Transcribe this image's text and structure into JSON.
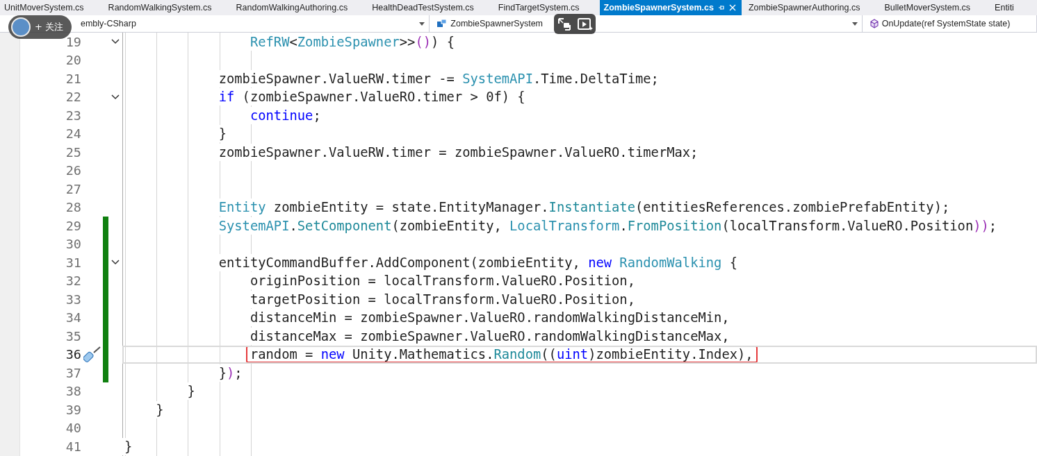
{
  "tabs": [
    {
      "label": "UnitMoverSystem.cs",
      "selected": false
    },
    {
      "label": "RandomWalkingSystem.cs",
      "selected": false
    },
    {
      "label": "RandomWalkingAuthoring.cs",
      "selected": false
    },
    {
      "label": "HealthDeadTestSystem.cs",
      "selected": false
    },
    {
      "label": "FindTargetSystem.cs",
      "selected": false
    },
    {
      "label": "ZombieSpawnerSystem.cs",
      "selected": true
    },
    {
      "label": "ZombieSpawnerAuthoring.cs",
      "selected": false
    },
    {
      "label": "BulletMoverSystem.cs",
      "selected": false
    },
    {
      "label": "Entiti",
      "selected": false
    }
  ],
  "navigation_bar": {
    "project": "embly-CSharp",
    "type": "ZombieSpawnerSystem",
    "member": "OnUpdate(ref SystemState state)"
  },
  "video_overlay": {
    "follow_label": "+ 关注"
  },
  "editor": {
    "lines": [
      {
        "number": "19",
        "fold": true,
        "changed": false,
        "current": false,
        "boxed": false,
        "tokens": [
          {
            "t": "                RefRW",
            "kind": "type"
          },
          {
            "t": "<",
            "kind": "plain"
          },
          {
            "t": "ZombieSpawner",
            "kind": "type"
          },
          {
            "t": ">>",
            "kind": "plain"
          },
          {
            "t": "()",
            "kind": "paren"
          },
          {
            "t": ") {",
            "kind": "plain"
          }
        ]
      },
      {
        "number": "20",
        "fold": false,
        "changed": false,
        "current": false
      },
      {
        "number": "21",
        "fold": false,
        "changed": false,
        "current": false,
        "boxed": false,
        "tokens": [
          {
            "t": "            zombieSpawner.ValueRW.timer -= ",
            "kind": "plain"
          },
          {
            "t": "SystemAPI",
            "kind": "type"
          },
          {
            "t": ".Time.DeltaTime;",
            "kind": "plain"
          }
        ]
      },
      {
        "number": "22",
        "fold": true,
        "changed": false,
        "current": false,
        "boxed": false,
        "tokens": [
          {
            "t": "            if",
            "kind": "keyword"
          },
          {
            "t": " (zombieSpawner.ValueRO.timer > 0f) {",
            "kind": "plain"
          }
        ]
      },
      {
        "number": "23",
        "fold": false,
        "changed": false,
        "current": false,
        "boxed": false,
        "tokens": [
          {
            "t": "                continue",
            "kind": "keyword"
          },
          {
            "t": ";",
            "kind": "plain"
          }
        ]
      },
      {
        "number": "24",
        "fold": false,
        "changed": false,
        "current": false,
        "boxed": false,
        "tokens": [
          {
            "t": "            }",
            "kind": "plain"
          }
        ]
      },
      {
        "number": "25",
        "fold": false,
        "changed": false,
        "current": false,
        "boxed": false,
        "tokens": [
          {
            "t": "            zombieSpawner.ValueRW.timer = zombieSpawner.ValueRO.timerMax;",
            "kind": "plain"
          }
        ]
      },
      {
        "number": "26",
        "fold": false,
        "changed": false,
        "current": false
      },
      {
        "number": "27",
        "fold": false,
        "changed": false,
        "current": false
      },
      {
        "number": "28",
        "fold": false,
        "changed": false,
        "current": false,
        "boxed": false,
        "tokens": [
          {
            "t": "            Entity",
            "kind": "type"
          },
          {
            "t": " zombieEntity = state.EntityManager.",
            "kind": "plain"
          },
          {
            "t": "Instantiate",
            "kind": "method"
          },
          {
            "t": "(entitiesReferences.zombiePrefabEntity);",
            "kind": "plain"
          }
        ]
      },
      {
        "number": "29",
        "fold": false,
        "changed": true,
        "current": false,
        "boxed": false,
        "tokens": [
          {
            "t": "            SystemAPI",
            "kind": "type"
          },
          {
            "t": ".",
            "kind": "plain"
          },
          {
            "t": "SetComponent",
            "kind": "method"
          },
          {
            "t": "(zombieEntity, ",
            "kind": "plain"
          },
          {
            "t": "LocalTransform",
            "kind": "type"
          },
          {
            "t": ".",
            "kind": "plain"
          },
          {
            "t": "FromPosition",
            "kind": "method"
          },
          {
            "t": "(localTransform.ValueRO.Position",
            "kind": "plain"
          },
          {
            "t": "))",
            "kind": "paren"
          },
          {
            "t": ";",
            "kind": "plain"
          }
        ]
      },
      {
        "number": "30",
        "fold": false,
        "changed": true,
        "current": false
      },
      {
        "number": "31",
        "fold": true,
        "changed": true,
        "current": false,
        "boxed": false,
        "tokens": [
          {
            "t": "            entityCommandBuffer.AddComponent(zombieEntity, ",
            "kind": "plain"
          },
          {
            "t": "new",
            "kind": "keyword"
          },
          {
            "t": " RandomWalking",
            "kind": "type"
          },
          {
            "t": " {",
            "kind": "plain"
          }
        ]
      },
      {
        "number": "32",
        "fold": false,
        "changed": true,
        "current": false,
        "boxed": false,
        "tokens": [
          {
            "t": "                originPosition = localTransform.ValueRO.Position,",
            "kind": "plain"
          }
        ]
      },
      {
        "number": "33",
        "fold": false,
        "changed": true,
        "current": false,
        "boxed": false,
        "tokens": [
          {
            "t": "                targetPosition = localTransform.ValueRO.Position,",
            "kind": "plain"
          }
        ]
      },
      {
        "number": "34",
        "fold": false,
        "changed": true,
        "current": false,
        "boxed": false,
        "tokens": [
          {
            "t": "                distanceMin = zombieSpawner.ValueRO.randomWalkingDistanceMin,",
            "kind": "plain"
          }
        ]
      },
      {
        "number": "35",
        "fold": false,
        "changed": true,
        "current": false,
        "boxed": false,
        "tokens": [
          {
            "t": "                distanceMax = zombieSpawner.ValueRO.randomWalkingDistanceMax,",
            "kind": "plain"
          }
        ]
      },
      {
        "number": "36",
        "fold": false,
        "changed": true,
        "current": true,
        "boxed": true,
        "tokens": [
          {
            "t": "                random = ",
            "kind": "plain"
          },
          {
            "t": "new",
            "kind": "keyword"
          },
          {
            "t": " Unity.Mathematics.",
            "kind": "plain"
          },
          {
            "t": "Random",
            "kind": "method"
          },
          {
            "t": "((",
            "kind": "plain"
          },
          {
            "t": "uint",
            "kind": "keyword"
          },
          {
            "t": ")zombieEntity.Index)",
            "kind": "plain"
          },
          {
            "t": ",",
            "kind": "plain"
          }
        ]
      },
      {
        "number": "37",
        "fold": false,
        "changed": true,
        "current": false,
        "boxed": false,
        "tokens": [
          {
            "t": "            }",
            "kind": "plain"
          },
          {
            "t": ")",
            "kind": "paren"
          },
          {
            "t": ";",
            "kind": "plain"
          }
        ]
      },
      {
        "number": "38",
        "fold": false,
        "changed": false,
        "current": false,
        "boxed": false,
        "tokens": [
          {
            "t": "        }",
            "kind": "plain"
          }
        ]
      },
      {
        "number": "39",
        "fold": false,
        "changed": false,
        "current": false,
        "boxed": false,
        "tokens": [
          {
            "t": "    }",
            "kind": "plain"
          }
        ]
      },
      {
        "number": "40",
        "fold": false,
        "changed": false,
        "current": false
      },
      {
        "number": "41",
        "fold": false,
        "changed": false,
        "current": false,
        "boxed": false,
        "tokens": [
          {
            "t": "}",
            "kind": "plain"
          }
        ]
      }
    ]
  }
}
